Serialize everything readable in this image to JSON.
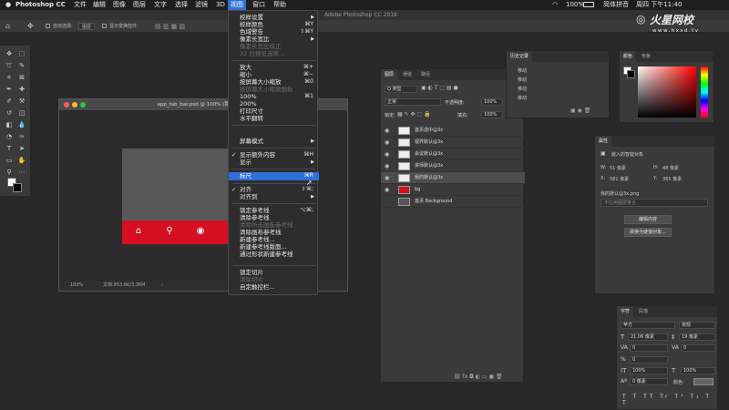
{
  "menubar": {
    "apple": "",
    "app_name": "Photoshop CC",
    "items": [
      "文件",
      "编辑",
      "图像",
      "图层",
      "文字",
      "选择",
      "滤镜",
      "3D",
      "视图",
      "窗口",
      "帮助"
    ],
    "battery": "100%",
    "input_label": "简体拼音",
    "datetime": "周四 下午11:40"
  },
  "titlebar": {
    "text": "Adobe Photoshop CC 2019"
  },
  "optbar": {
    "auto_select_label": "自动选择:",
    "auto_select_value": "图层",
    "show_transform_label": "显示变换控件"
  },
  "document": {
    "title": "app_tab_bar.psd @ 100% (我的默认...",
    "zoom": "100%",
    "doc_info": "文档:953.6K/3.36M"
  },
  "view_menu": {
    "items": [
      {
        "label": "校样设置",
        "shortcut": "",
        "arrow": true,
        "disabled": false
      },
      {
        "label": "校样颜色",
        "shortcut": "⌘Y",
        "arrow": false,
        "disabled": false
      },
      {
        "label": "色域警告",
        "shortcut": "⇧⌘Y",
        "arrow": false,
        "disabled": false
      },
      {
        "label": "像素长宽比",
        "shortcut": "",
        "arrow": true,
        "disabled": false
      },
      {
        "label": "像素长宽比校正",
        "shortcut": "",
        "arrow": false,
        "disabled": true
      },
      {
        "label": "32 位预览选项...",
        "shortcut": "",
        "arrow": false,
        "disabled": true
      },
      {
        "label": "放大",
        "shortcut": "⌘+",
        "arrow": false,
        "disabled": false
      },
      {
        "label": "缩小",
        "shortcut": "⌘−",
        "arrow": false,
        "disabled": false
      },
      {
        "label": "按屏幕大小缩放",
        "shortcut": "⌘0",
        "arrow": false,
        "disabled": false
      },
      {
        "label": "按屏幕大小缩放画板",
        "shortcut": "",
        "arrow": false,
        "disabled": true
      },
      {
        "label": "100%",
        "shortcut": "⌘1",
        "arrow": false,
        "disabled": false
      },
      {
        "label": "200%",
        "shortcut": "",
        "arrow": false,
        "disabled": false
      },
      {
        "label": "打印尺寸",
        "shortcut": "",
        "arrow": false,
        "disabled": false
      },
      {
        "label": "水平翻转",
        "shortcut": "",
        "arrow": false,
        "disabled": false
      },
      {
        "label": "屏幕模式",
        "shortcut": "",
        "arrow": true,
        "disabled": false
      },
      {
        "label": "显示额外内容",
        "shortcut": "⌘H",
        "arrow": false,
        "disabled": false,
        "checked": true
      },
      {
        "label": "显示",
        "shortcut": "",
        "arrow": true,
        "disabled": false
      },
      {
        "label": "标尺",
        "shortcut": "⌘R",
        "arrow": false,
        "disabled": false,
        "highlighted": true
      },
      {
        "label": "对齐",
        "shortcut": "⇧⌘;",
        "arrow": false,
        "disabled": false,
        "checked": true
      },
      {
        "label": "对齐到",
        "shortcut": "",
        "arrow": true,
        "disabled": false
      },
      {
        "label": "锁定参考线",
        "shortcut": "⌥⌘;",
        "arrow": false,
        "disabled": false
      },
      {
        "label": "清除参考线",
        "shortcut": "",
        "arrow": false,
        "disabled": false
      },
      {
        "label": "清除所选画板参考线",
        "shortcut": "",
        "arrow": false,
        "disabled": true
      },
      {
        "label": "清除画布参考线",
        "shortcut": "",
        "arrow": false,
        "disabled": false
      },
      {
        "label": "新建参考线...",
        "shortcut": "",
        "arrow": false,
        "disabled": false
      },
      {
        "label": "新建参考线版面...",
        "shortcut": "",
        "arrow": false,
        "disabled": false
      },
      {
        "label": "通过形状新建参考线",
        "shortcut": "",
        "arrow": false,
        "disabled": false
      },
      {
        "label": "锁定切片",
        "shortcut": "",
        "arrow": false,
        "disabled": false
      },
      {
        "label": "清除切片",
        "shortcut": "",
        "arrow": false,
        "disabled": true
      },
      {
        "label": "自定触控栏...",
        "shortcut": "",
        "arrow": false,
        "disabled": false
      }
    ]
  },
  "layers_panel": {
    "tabs": [
      "图层",
      "通道",
      "路径"
    ],
    "kind_label": "Q 类型",
    "blend_mode": "正常",
    "opacity_label": "不透明度:",
    "opacity_value": "100%",
    "lock_label": "锁定:",
    "fill_label": "填充:",
    "fill_value": "100%",
    "layers": [
      {
        "name": "首页选中@3x",
        "selected": false
      },
      {
        "name": "视界默认@3x",
        "selected": false
      },
      {
        "name": "会议默认@3x",
        "selected": false
      },
      {
        "name": "讲师默认@3x",
        "selected": false
      },
      {
        "name": "我的默认@3x",
        "selected": true
      },
      {
        "name": "bg",
        "selected": false
      },
      {
        "name": "首页 Background",
        "selected": false
      }
    ]
  },
  "history_panel": {
    "title": "历史记录",
    "rows": [
      "移动",
      "移动",
      "移动",
      "移动"
    ]
  },
  "color_panel": {
    "tabs": [
      "颜色",
      "色板"
    ]
  },
  "properties_panel": {
    "title": "属性",
    "subtitle": "嵌入的智能对象",
    "w_label": "W:",
    "w_value": "51 像素",
    "h_label": "H:",
    "h_value": "48 像素",
    "x_label": "X:",
    "x_value": "581 像素",
    "y_label": "Y:",
    "y_value": "365 像素",
    "file_name": "我的默认@3x.png",
    "comps_placeholder": "不应用图层复合",
    "edit_button": "编辑内容",
    "convert_button": "转换为链接对象..."
  },
  "character_panel": {
    "tabs": [
      "字符",
      "段落"
    ],
    "font": "苹方",
    "style": "常规",
    "size": "21.06 像素",
    "leading": "19 像素",
    "kerning": "0",
    "tracking": "0",
    "vscale": "100%",
    "hscale": "100%",
    "baseline": "0 像素",
    "color_label": "颜色:"
  },
  "watermark": {
    "main": "火星网校",
    "sub": "www.hxsd.tv"
  }
}
